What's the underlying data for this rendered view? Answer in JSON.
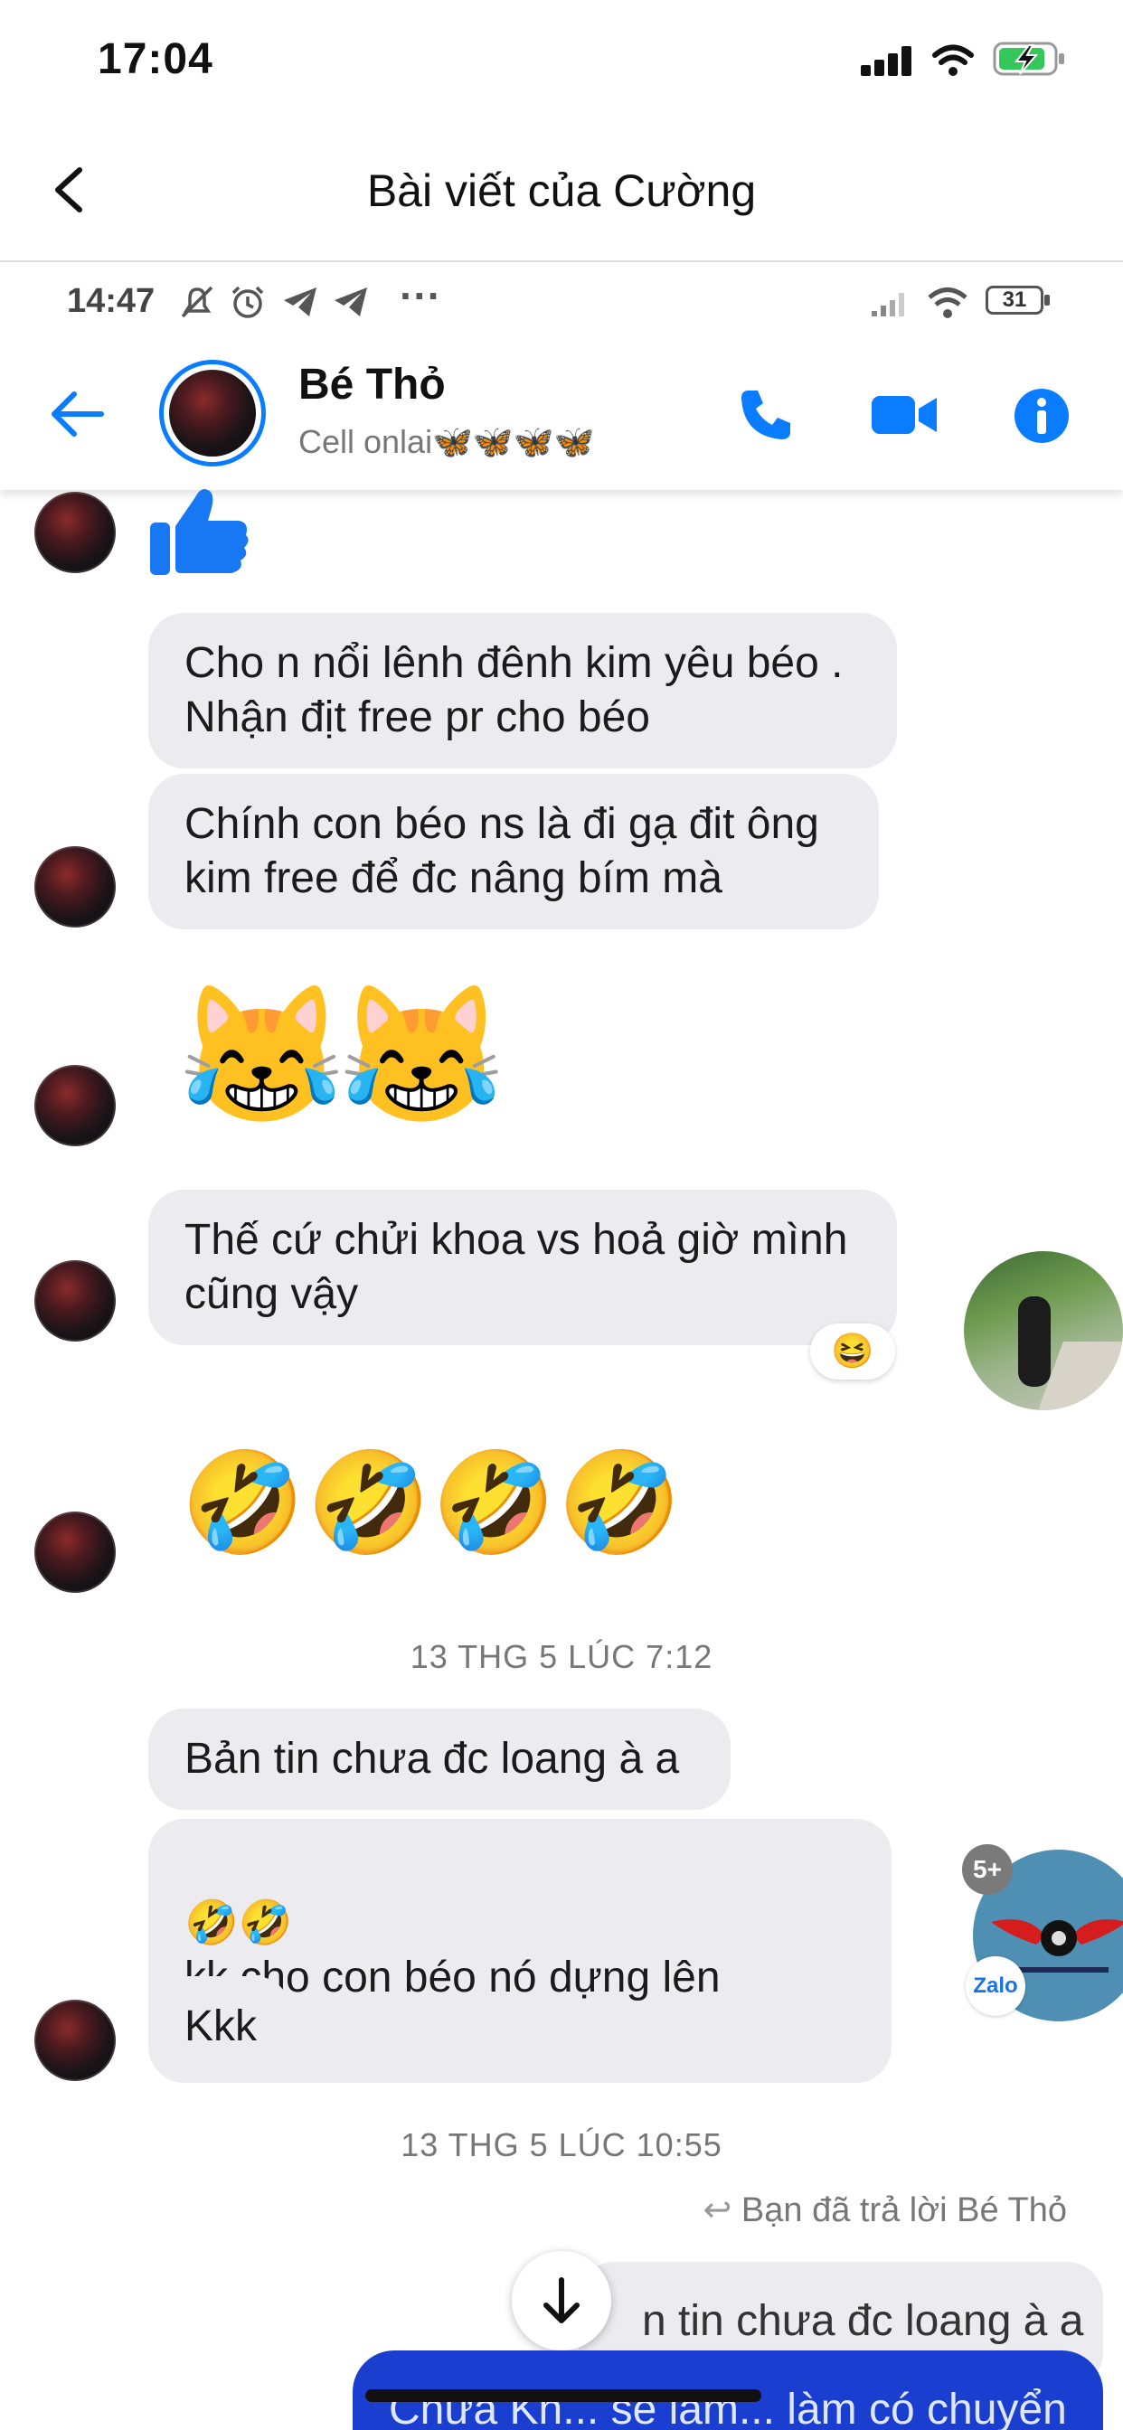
{
  "ios_status": {
    "time": "17:04"
  },
  "outer_nav": {
    "title": "Bài viết của Cường"
  },
  "inner_status": {
    "time": "14:47",
    "dots": "···",
    "battery": "31"
  },
  "header": {
    "contact_name": "Bé Thỏ",
    "contact_status": "Cell onlai🦋🦋🦋🦋"
  },
  "messages": [
    {
      "text": "Cho n nổi lênh đênh kim yêu béo .\nNhận địt free pr cho béo"
    },
    {
      "text": "Chính con béo ns là đi gạ đit ông\nkim free để đc nâng bím mà"
    },
    {
      "text": "Thế cứ chửi khoa vs hoả giờ mình\ncũng vậy",
      "reaction": "😆"
    },
    {
      "text": "Bản tin chưa đc loang à a"
    },
    {
      "text": "kk cho con béo nó dựng lên\nchửi",
      "prefix_emoji": "🤣🤣"
    },
    {
      "text": "Kkk"
    }
  ],
  "emoji_rows": {
    "cats": "😹😹",
    "rofl": "🤣🤣🤣🤣"
  },
  "timestamps": [
    "13 THG 5 LÚC 7:12",
    "13 THG 5 LÚC 10:55"
  ],
  "reply": {
    "label": "Bạn đã trả lời Bé Thỏ",
    "quote": "n tin chưa đc loang à a",
    "outgoing_partial": "Chưa Kh... sé làm... làm có chuyển"
  },
  "chat_head": {
    "badge": "5+",
    "app": "Zalo"
  },
  "colors": {
    "messenger_blue": "#0a7cff",
    "bubble_gray": "#ebebf0",
    "outgoing_blue": "#1a3fd0"
  }
}
